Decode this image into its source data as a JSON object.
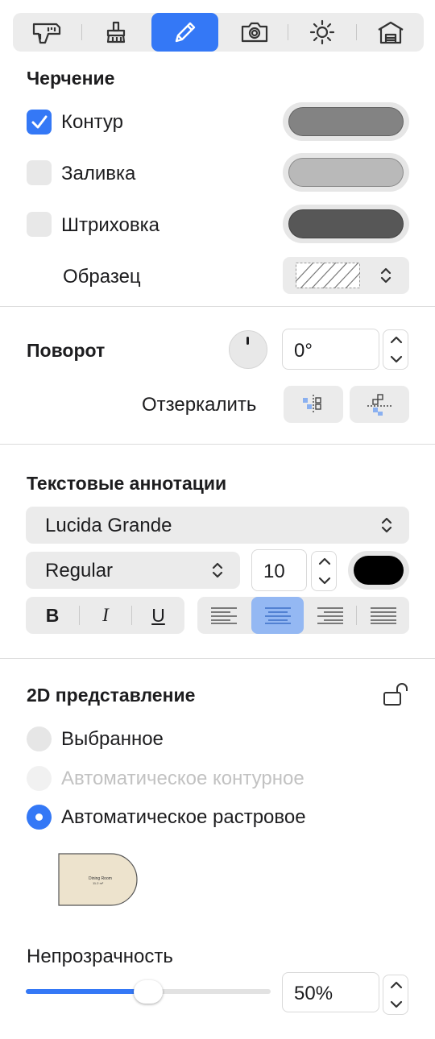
{
  "toolbar": {
    "tabs": [
      {
        "icon": "ruler-tool-icon",
        "active": false
      },
      {
        "icon": "stamp-icon",
        "active": false
      },
      {
        "icon": "pencil-icon",
        "active": true
      },
      {
        "icon": "camera-icon",
        "active": false
      },
      {
        "icon": "sun-icon",
        "active": false
      },
      {
        "icon": "house-icon",
        "active": false
      }
    ],
    "accent_color": "#3478f6"
  },
  "drafting": {
    "title": "Черчение",
    "outline": {
      "label": "Контур",
      "checked": true,
      "color": "#838383"
    },
    "fill": {
      "label": "Заливка",
      "checked": false,
      "color": "#b9b9b9"
    },
    "hatch": {
      "label": "Штриховка",
      "checked": false,
      "color": "#575757"
    },
    "pattern": {
      "label": "Образец"
    }
  },
  "rotation": {
    "title": "Поворот",
    "value": "0°",
    "mirror_label": "Отзеркалить"
  },
  "text_annotations": {
    "title": "Текстовые аннотации",
    "font_family": "Lucida Grande",
    "font_style": "Regular",
    "font_size": "10",
    "text_color": "#000000",
    "bold_label": "B",
    "italic_label": "I",
    "underline_label": "U",
    "alignment_selected": "center"
  },
  "representation_2d": {
    "title": "2D представление",
    "options": [
      {
        "label": "Выбранное",
        "selected": false,
        "disabled": false
      },
      {
        "label": "Автоматическое контурное",
        "selected": false,
        "disabled": true
      },
      {
        "label": "Автоматическое растровое",
        "selected": true,
        "disabled": false
      }
    ],
    "preview_caption": "Dining Room",
    "preview_sub": "11.2 m²"
  },
  "opacity": {
    "label": "Непрозрачность",
    "value": "50%",
    "fraction": 0.5
  }
}
